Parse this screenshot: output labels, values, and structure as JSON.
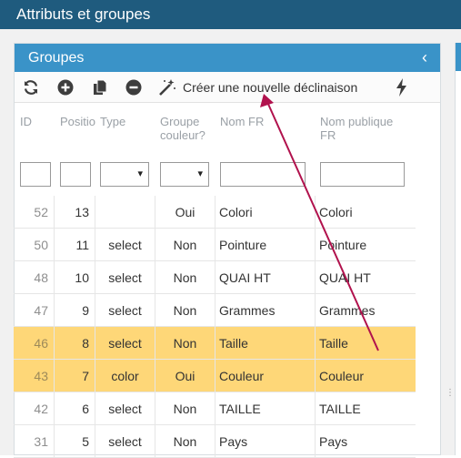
{
  "topbar": {
    "title": "Attributs et groupes"
  },
  "panel": {
    "title": "Groupes",
    "collapse_glyph": "‹"
  },
  "toolbar": {
    "create_label": "Créer une nouvelle déclinaison"
  },
  "columns": {
    "id": "ID",
    "position": "Positio",
    "type": "Type",
    "group_line1": "Groupe",
    "group_line2": "couleur?",
    "name_fr": "Nom FR",
    "public_line1": "Nom publique",
    "public_line2": "FR"
  },
  "colors": {
    "topbar": "#1f5b7e",
    "panel_header": "#3a93c8",
    "selected_row": "#fed778"
  },
  "rows": [
    {
      "id": "52",
      "position": "13",
      "type": "",
      "group": "Oui",
      "name": "Colori",
      "public": "Colori",
      "selected": false
    },
    {
      "id": "50",
      "position": "11",
      "type": "select",
      "group": "Non",
      "name": "Pointure",
      "public": "Pointure",
      "selected": false
    },
    {
      "id": "48",
      "position": "10",
      "type": "select",
      "group": "Non",
      "name": "QUAI HT",
      "public": "QUAI HT",
      "selected": false
    },
    {
      "id": "47",
      "position": "9",
      "type": "select",
      "group": "Non",
      "name": "Grammes",
      "public": "Grammes",
      "selected": false
    },
    {
      "id": "46",
      "position": "8",
      "type": "select",
      "group": "Non",
      "name": "Taille",
      "public": "Taille",
      "selected": true
    },
    {
      "id": "43",
      "position": "7",
      "type": "color",
      "group": "Oui",
      "name": "Couleur",
      "public": "Couleur",
      "selected": true
    },
    {
      "id": "42",
      "position": "6",
      "type": "select",
      "group": "Non",
      "name": "TAILLE",
      "public": "TAILLE",
      "selected": false
    },
    {
      "id": "31",
      "position": "5",
      "type": "select",
      "group": "Non",
      "name": "Pays",
      "public": "Pays",
      "selected": false
    }
  ]
}
